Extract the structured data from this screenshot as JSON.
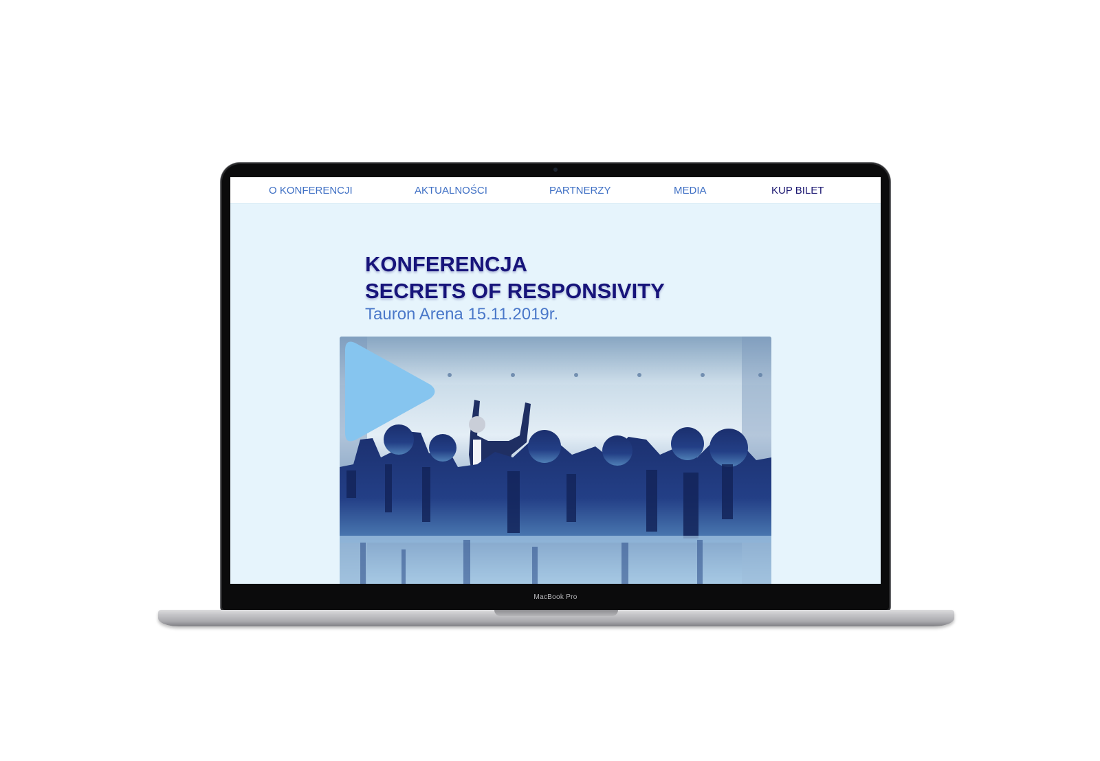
{
  "device": {
    "model_label": "MacBook Pro"
  },
  "nav": {
    "items": [
      {
        "label": "O KONFERENCJI"
      },
      {
        "label": "AKTUALNOŚCI"
      },
      {
        "label": "PARTNERZY"
      },
      {
        "label": "MEDIA"
      },
      {
        "label": "KUP BILET"
      }
    ]
  },
  "hero": {
    "title_line1": "KONFERENCJA",
    "title_line2": "SECRETS OF RESPONSIVITY",
    "subtitle": "Tauron Arena  15.11.2019r."
  },
  "video": {
    "play_icon": "play-icon",
    "play_color": "#86c5ef"
  },
  "colors": {
    "screen_background": "#e6f4fc",
    "title": "#17147a",
    "subtitle": "#4a78c9",
    "nav_link": "#3e6fc4",
    "nav_cta": "#1a1670"
  }
}
